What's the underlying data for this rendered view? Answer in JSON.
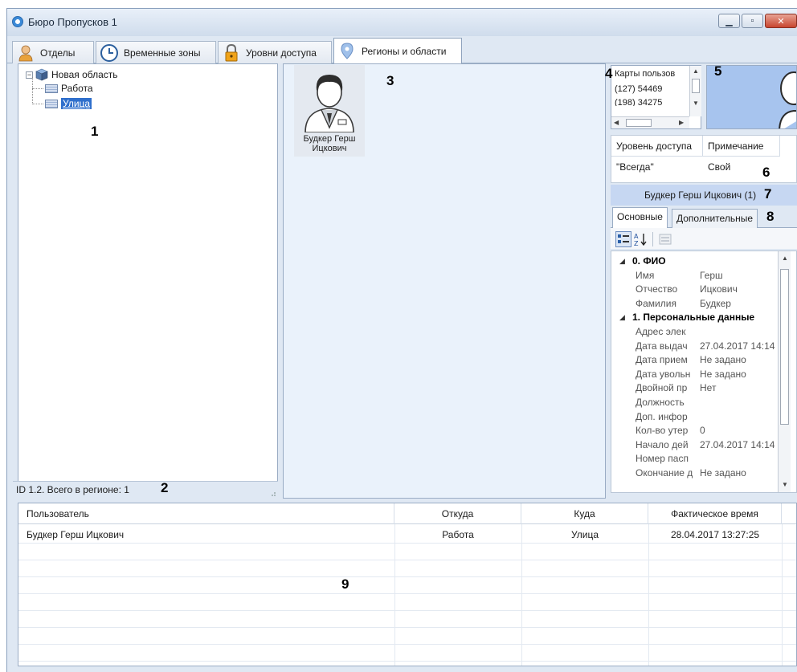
{
  "window": {
    "title": "Бюро Пропусков 1"
  },
  "tabs": [
    {
      "label": "Отделы",
      "icon": "person-icon"
    },
    {
      "label": "Временные зоны",
      "icon": "clock-icon"
    },
    {
      "label": "Уровни доступа",
      "icon": "lock-icon"
    },
    {
      "label": "Регионы и области",
      "icon": "map-pin-icon",
      "active": true
    }
  ],
  "tree": {
    "root": "Новая область",
    "children": [
      "Работа",
      "Улица"
    ],
    "selected": "Улица"
  },
  "status": {
    "text": "ID 1.2. Всего в регионе: 1"
  },
  "region_users": [
    {
      "name": "Будкер Герш Ицкович"
    }
  ],
  "cards": {
    "title": "Карты пользов",
    "items": [
      "(127) 54469",
      "(198) 34275"
    ]
  },
  "access_grid": {
    "headers": [
      "Уровень доступа",
      "Примечание"
    ],
    "rows": [
      {
        "level": "\"Всегда\"",
        "note": "Свой"
      }
    ]
  },
  "selected_user": {
    "header": "Будкер Герш Ицкович (1)"
  },
  "property_tabs": [
    "Основные",
    "Дополнительные"
  ],
  "properties": [
    {
      "type": "category",
      "label": "0. ФИО"
    },
    {
      "type": "prop",
      "name": "Имя",
      "value": "Герш"
    },
    {
      "type": "prop",
      "name": "Отчество",
      "value": "Ицкович"
    },
    {
      "type": "prop",
      "name": "Фамилия",
      "value": "Будкер"
    },
    {
      "type": "category",
      "label": "1. Персональные данные"
    },
    {
      "type": "prop",
      "name": "Адрес элек",
      "value": ""
    },
    {
      "type": "prop",
      "name": "Дата выдач",
      "value": "27.04.2017 14:14"
    },
    {
      "type": "prop",
      "name": "Дата прием",
      "value": "Не задано"
    },
    {
      "type": "prop",
      "name": "Дата увольн",
      "value": "Не задано"
    },
    {
      "type": "prop",
      "name": "Двойной пр",
      "value": "Нет"
    },
    {
      "type": "prop",
      "name": "Должность",
      "value": ""
    },
    {
      "type": "prop",
      "name": "Доп. инфор",
      "value": ""
    },
    {
      "type": "prop",
      "name": "Кол-во утер",
      "value": "0"
    },
    {
      "type": "prop",
      "name": "Начало дей",
      "value": "27.04.2017 14:14"
    },
    {
      "type": "prop",
      "name": "Номер пасп",
      "value": ""
    },
    {
      "type": "prop",
      "name": "Окончание д",
      "value": "Не задано"
    }
  ],
  "events": {
    "headers": [
      "Пользователь",
      "Откуда",
      "Куда",
      "Фактическое время"
    ],
    "rows": [
      {
        "user": "Будкер Герш Ицкович",
        "from": "Работа",
        "to": "Улица",
        "time": "28.04.2017 13:27:25"
      }
    ]
  },
  "callouts": [
    "1",
    "2",
    "3",
    "4",
    "5",
    "6",
    "7",
    "8",
    "9"
  ],
  "colors": {
    "selection": "#2f6fcc",
    "panel": "#eaf2fb",
    "header_band": "#c6d7f2"
  }
}
